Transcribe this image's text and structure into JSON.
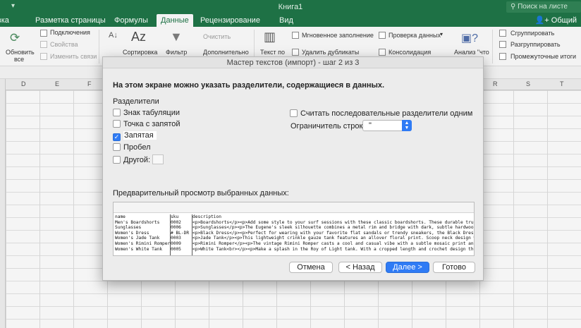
{
  "window": {
    "title": "Книга1",
    "search_placeholder": "Поиск на листе",
    "share_label": "Общий"
  },
  "ribbon_tabs": [
    {
      "label": "Вставка"
    },
    {
      "label": "Разметка страницы"
    },
    {
      "label": "Формулы"
    },
    {
      "label": "Данные",
      "active": true
    },
    {
      "label": "Рецензирование"
    },
    {
      "label": "Вид"
    }
  ],
  "ribbon": {
    "refresh_all": [
      "Обновить",
      "все"
    ],
    "connections": "Подключения",
    "properties": "Свойства",
    "edit_links": "Изменить связи",
    "sort": "Сортировка",
    "filter": "Фильтр",
    "clear": "Очистить",
    "advanced": "Дополнительно",
    "text_to_columns": "Текст по",
    "flash_fill": "Мгновенное заполнение",
    "remove_duplicates": "Удалить дубликаты",
    "data_validation": "Проверка данных",
    "consolidate": "Консолидация",
    "what_if": "Анализ \"что",
    "group": "Сгруппировать",
    "ungroup": "Разгруппировать",
    "subtotal": "Промежуточные итоги"
  },
  "grid": {
    "columns_left": [
      "D",
      "E",
      "F"
    ],
    "columns_right": [
      "R",
      "S",
      "T"
    ]
  },
  "dialog": {
    "title": "Мастер текстов (импорт) - шаг 2 из 3",
    "heading": "На этом экране можно указать разделители, содержащиеся в данных.",
    "delimiters_label": "Разделители",
    "delimiters": [
      {
        "label": "Знак табуляции",
        "checked": false
      },
      {
        "label": "Точка с запятой",
        "checked": false
      },
      {
        "label": "Запятая",
        "checked": true
      },
      {
        "label": "Пробел",
        "checked": false
      },
      {
        "label": "Другой:",
        "checked": false
      }
    ],
    "consecutive_label": "Считать последовательные разделители одним",
    "consecutive_checked": false,
    "text_qualifier_label": "Ограничитель строк:",
    "text_qualifier_value": "\"",
    "preview_label": "Предварительный просмотр выбранных данных:",
    "preview_rows": [
      [
        "name",
        "sku",
        "description"
      ],
      [
        "Men's Boardshorts",
        "0002",
        "<p>Boardshorts</p><p>Add some style to your surf sessions with these classic boardshorts. These durable trunk"
      ],
      [
        "Sunglasses",
        "0006",
        "<p>Sunglasses</p><p>The Eugene's sleek silhouette combines a metal rim and bridge with dark, subtle hardwoods"
      ],
      [
        "Women's Dress",
        "# BL-DR",
        "<p>Black Dress</p><p>Perfect for wearing with your favorite flat sandals or trendy sneakers, the Black Dress"
      ],
      [
        "Women's Jade Tank",
        "0003",
        "<p>Jade Tank</p><p>This lightweight crinkle gauze tank features an allover floral print. Scoop neck design wi"
      ],
      [
        "Women's Rimini Romper",
        "0009",
        "<p>Rimini Romper</p><p>The vintage Rimini Romper casts a cool and casual vibe with a subtle mosaic print and"
      ],
      [
        "Women's White Tank",
        "0005",
        "<p>White Tank<br></p><p>Make a splash in the Roy of Light tank. With a cropped length and crochet design this"
      ]
    ],
    "buttons": {
      "cancel": "Отмена",
      "back": "< Назад",
      "next": "Далее >",
      "finish": "Готово"
    }
  },
  "colors": {
    "excel_green": "#1e7145",
    "accent_blue": "#2f7bf5"
  }
}
